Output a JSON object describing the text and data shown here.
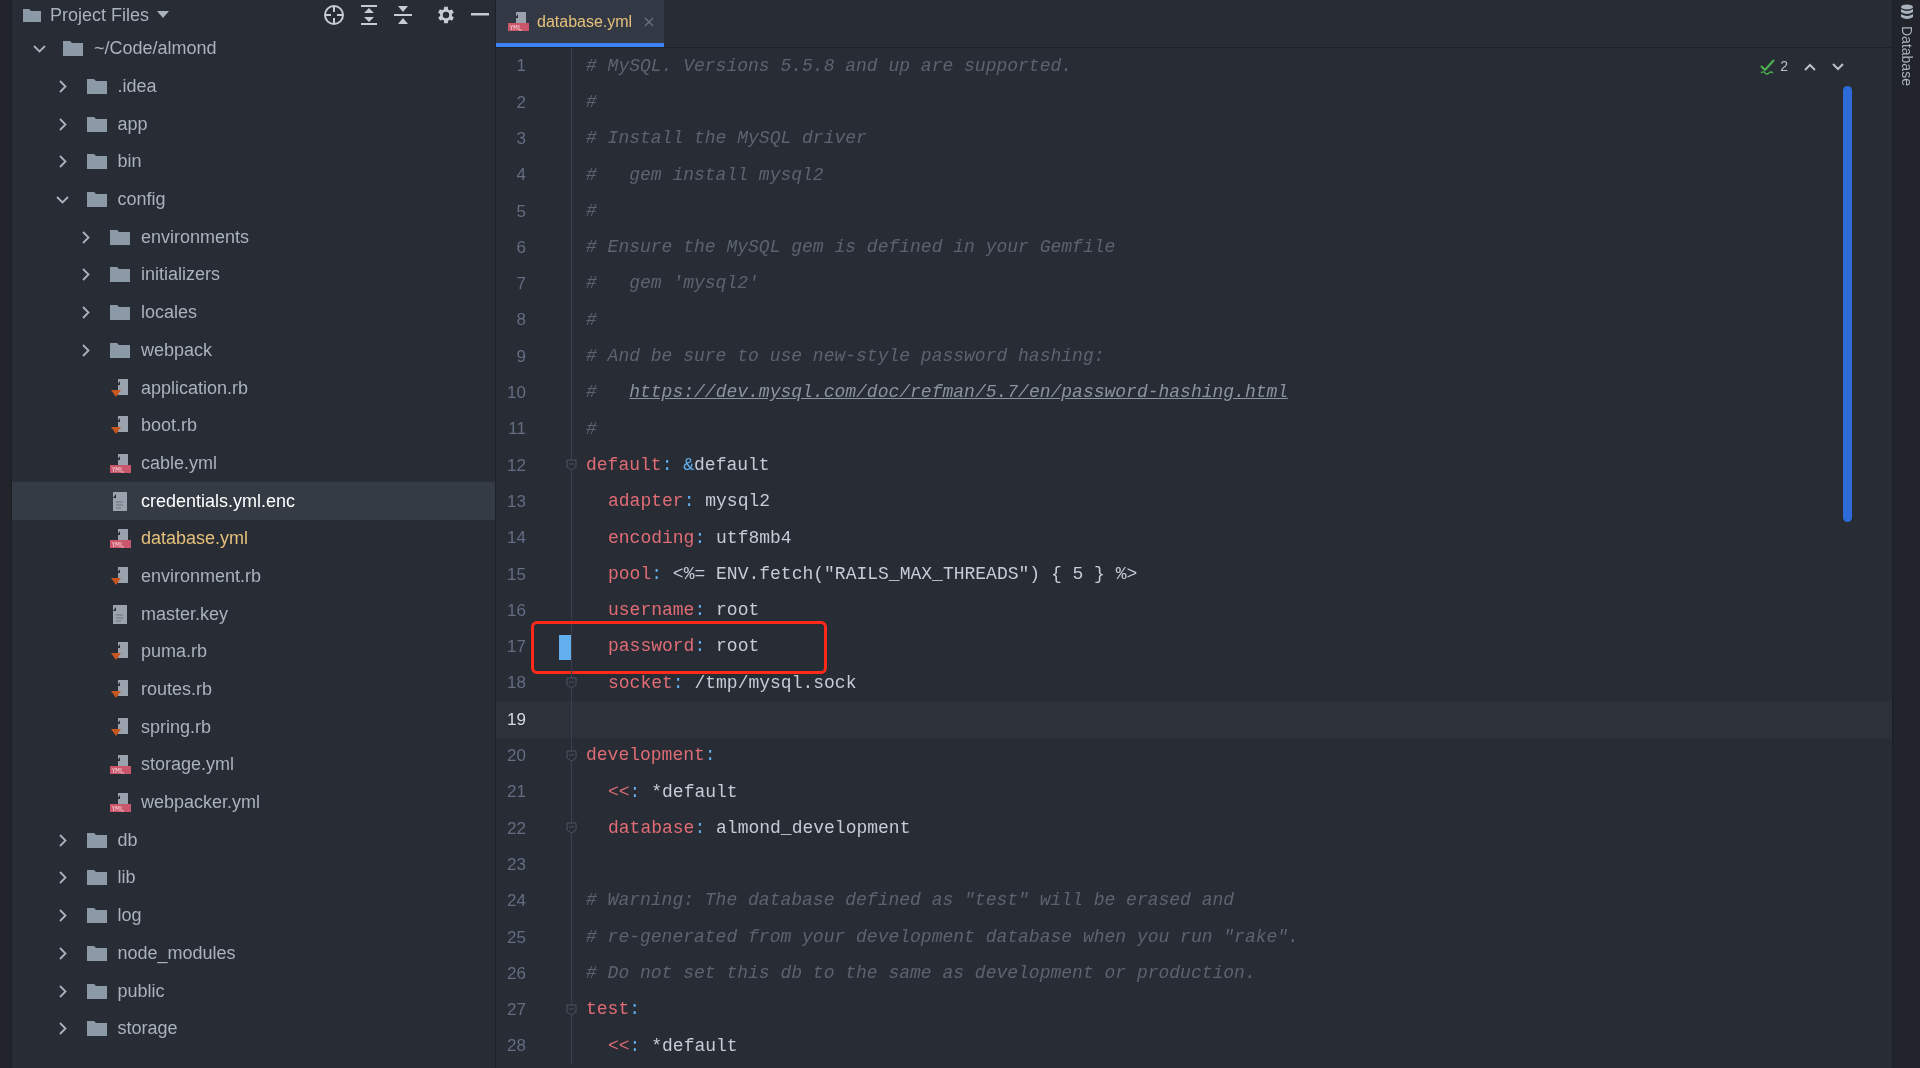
{
  "project_panel": {
    "title": "Project Files",
    "tree": [
      {
        "label": "~/Code/almond",
        "kind": "folder",
        "expanded": true,
        "selected": false,
        "modified": false,
        "children": [
          {
            "label": ".idea",
            "kind": "folder",
            "expanded": false,
            "selected": false,
            "modified": false
          },
          {
            "label": "app",
            "kind": "folder",
            "expanded": false,
            "selected": false,
            "modified": false
          },
          {
            "label": "bin",
            "kind": "folder",
            "expanded": false,
            "selected": false,
            "modified": false
          },
          {
            "label": "config",
            "kind": "folder",
            "expanded": true,
            "selected": false,
            "modified": false,
            "children": [
              {
                "label": "environments",
                "kind": "folder",
                "expanded": false,
                "selected": false,
                "modified": false
              },
              {
                "label": "initializers",
                "kind": "folder",
                "expanded": false,
                "selected": false,
                "modified": false
              },
              {
                "label": "locales",
                "kind": "folder",
                "expanded": false,
                "selected": false,
                "modified": false
              },
              {
                "label": "webpack",
                "kind": "folder",
                "expanded": false,
                "selected": false,
                "modified": false
              },
              {
                "label": "application.rb",
                "kind": "ruby",
                "selected": false,
                "modified": false
              },
              {
                "label": "boot.rb",
                "kind": "ruby",
                "selected": false,
                "modified": false
              },
              {
                "label": "cable.yml",
                "kind": "yaml",
                "selected": false,
                "modified": false
              },
              {
                "label": "credentials.yml.enc",
                "kind": "text",
                "selected": true,
                "modified": false
              },
              {
                "label": "database.yml",
                "kind": "yaml",
                "selected": false,
                "modified": true
              },
              {
                "label": "environment.rb",
                "kind": "ruby",
                "selected": false,
                "modified": false
              },
              {
                "label": "master.key",
                "kind": "text",
                "selected": false,
                "modified": false
              },
              {
                "label": "puma.rb",
                "kind": "ruby",
                "selected": false,
                "modified": false
              },
              {
                "label": "routes.rb",
                "kind": "ruby",
                "selected": false,
                "modified": false
              },
              {
                "label": "spring.rb",
                "kind": "ruby",
                "selected": false,
                "modified": false
              },
              {
                "label": "storage.yml",
                "kind": "yaml",
                "selected": false,
                "modified": false
              },
              {
                "label": "webpacker.yml",
                "kind": "yaml",
                "selected": false,
                "modified": false
              }
            ]
          },
          {
            "label": "db",
            "kind": "folder",
            "expanded": false,
            "selected": false,
            "modified": false
          },
          {
            "label": "lib",
            "kind": "folder",
            "expanded": false,
            "selected": false,
            "modified": false
          },
          {
            "label": "log",
            "kind": "folder",
            "expanded": false,
            "selected": false,
            "modified": false
          },
          {
            "label": "node_modules",
            "kind": "folder",
            "expanded": false,
            "selected": false,
            "modified": false
          },
          {
            "label": "public",
            "kind": "folder",
            "expanded": false,
            "selected": false,
            "modified": false
          },
          {
            "label": "storage",
            "kind": "folder",
            "expanded": false,
            "selected": false,
            "modified": false
          }
        ]
      }
    ]
  },
  "tabs": [
    {
      "label": "database.yml",
      "selected": true
    }
  ],
  "inspections": {
    "count": "2"
  },
  "right_strip": {
    "label": "Database"
  },
  "editor": {
    "lines": [
      {
        "number": "1",
        "indented": false,
        "fold": false,
        "current": false,
        "changed": false,
        "boxed": false,
        "tokens": [
          {
            "kind": "comment",
            "text": "# MySQL. Versions 5.5.8 and up are supported."
          }
        ]
      },
      {
        "number": "2",
        "indented": false,
        "fold": false,
        "current": false,
        "changed": false,
        "boxed": false,
        "tokens": [
          {
            "kind": "comment",
            "text": "#"
          }
        ]
      },
      {
        "number": "3",
        "indented": false,
        "fold": false,
        "current": false,
        "changed": false,
        "boxed": false,
        "tokens": [
          {
            "kind": "comment",
            "text": "# Install the MySQL driver"
          }
        ]
      },
      {
        "number": "4",
        "indented": false,
        "fold": false,
        "current": false,
        "changed": false,
        "boxed": false,
        "tokens": [
          {
            "kind": "comment",
            "text": "#   gem install mysql2"
          }
        ]
      },
      {
        "number": "5",
        "indented": false,
        "fold": false,
        "current": false,
        "changed": false,
        "boxed": false,
        "tokens": [
          {
            "kind": "comment",
            "text": "#"
          }
        ]
      },
      {
        "number": "6",
        "indented": false,
        "fold": false,
        "current": false,
        "changed": false,
        "boxed": false,
        "tokens": [
          {
            "kind": "comment",
            "text": "# Ensure the MySQL gem is defined in your Gemfile"
          }
        ]
      },
      {
        "number": "7",
        "indented": false,
        "fold": false,
        "current": false,
        "changed": false,
        "boxed": false,
        "tokens": [
          {
            "kind": "comment",
            "text": "#   gem 'mysql2'"
          }
        ]
      },
      {
        "number": "8",
        "indented": false,
        "fold": false,
        "current": false,
        "changed": false,
        "boxed": false,
        "tokens": [
          {
            "kind": "comment",
            "text": "#"
          }
        ]
      },
      {
        "number": "9",
        "indented": false,
        "fold": false,
        "current": false,
        "changed": false,
        "boxed": false,
        "tokens": [
          {
            "kind": "comment",
            "text": "# And be sure to use new-style password hashing:"
          }
        ]
      },
      {
        "number": "10",
        "indented": false,
        "fold": false,
        "current": false,
        "changed": false,
        "boxed": false,
        "tokens": [
          {
            "kind": "comment",
            "text": "#   "
          },
          {
            "kind": "link",
            "text": "https://dev.mysql.com/doc/refman/5.7/en/password-hashing.html"
          }
        ]
      },
      {
        "number": "11",
        "indented": false,
        "fold": false,
        "current": false,
        "changed": false,
        "boxed": false,
        "tokens": [
          {
            "kind": "comment",
            "text": "#"
          }
        ]
      },
      {
        "number": "12",
        "indented": false,
        "fold": true,
        "current": false,
        "changed": false,
        "boxed": false,
        "tokens": [
          {
            "kind": "key",
            "text": "default"
          },
          {
            "kind": "punct",
            "text": ": &"
          },
          {
            "kind": "value",
            "text": "default"
          }
        ]
      },
      {
        "number": "13",
        "indented": true,
        "fold": false,
        "current": false,
        "changed": false,
        "boxed": false,
        "tokens": [
          {
            "kind": "key",
            "text": "adapter"
          },
          {
            "kind": "punct",
            "text": ":"
          },
          {
            "kind": "value",
            "text": " mysql2"
          }
        ]
      },
      {
        "number": "14",
        "indented": true,
        "fold": false,
        "current": false,
        "changed": false,
        "boxed": false,
        "tokens": [
          {
            "kind": "key",
            "text": "encoding"
          },
          {
            "kind": "punct",
            "text": ":"
          },
          {
            "kind": "value",
            "text": " utf8mb4"
          }
        ]
      },
      {
        "number": "15",
        "indented": true,
        "fold": false,
        "current": false,
        "changed": false,
        "boxed": false,
        "tokens": [
          {
            "kind": "key",
            "text": "pool"
          },
          {
            "kind": "punct",
            "text": ":"
          },
          {
            "kind": "value",
            "text": " <%= ENV.fetch(\"RAILS_MAX_THREADS\") { 5 } %>"
          }
        ]
      },
      {
        "number": "16",
        "indented": true,
        "fold": false,
        "current": false,
        "changed": false,
        "boxed": false,
        "tokens": [
          {
            "kind": "key",
            "text": "username"
          },
          {
            "kind": "punct",
            "text": ":"
          },
          {
            "kind": "value",
            "text": " root"
          }
        ]
      },
      {
        "number": "17",
        "indented": true,
        "fold": false,
        "current": false,
        "changed": true,
        "boxed": true,
        "tokens": [
          {
            "kind": "key",
            "text": "password"
          },
          {
            "kind": "punct",
            "text": ":"
          },
          {
            "kind": "value",
            "text": " root"
          }
        ]
      },
      {
        "number": "18",
        "indented": true,
        "fold": true,
        "current": false,
        "changed": false,
        "boxed": false,
        "tokens": [
          {
            "kind": "key",
            "text": "socket"
          },
          {
            "kind": "punct",
            "text": ":"
          },
          {
            "kind": "value",
            "text": " /tmp/mysql.sock"
          }
        ]
      },
      {
        "number": "19",
        "fold": false,
        "current": true,
        "changed": false,
        "boxed": false
      },
      {
        "number": "20",
        "indented": false,
        "fold": true,
        "current": false,
        "changed": false,
        "boxed": false,
        "tokens": [
          {
            "kind": "key",
            "text": "development"
          },
          {
            "kind": "punct",
            "text": ":"
          }
        ]
      },
      {
        "number": "21",
        "indented": true,
        "fold": false,
        "current": false,
        "changed": false,
        "boxed": false,
        "tokens": [
          {
            "kind": "key",
            "text": "<<"
          },
          {
            "kind": "punct",
            "text": ":"
          },
          {
            "kind": "value",
            "text": " *default"
          }
        ]
      },
      {
        "number": "22",
        "indented": true,
        "fold": true,
        "current": false,
        "changed": false,
        "boxed": false,
        "tokens": [
          {
            "kind": "key",
            "text": "database"
          },
          {
            "kind": "punct",
            "text": ":"
          },
          {
            "kind": "value",
            "text": " almond_development"
          }
        ]
      },
      {
        "number": "23",
        "fold": false,
        "current": false,
        "changed": false,
        "boxed": false
      },
      {
        "number": "24",
        "indented": false,
        "fold": false,
        "current": false,
        "changed": false,
        "boxed": false,
        "tokens": [
          {
            "kind": "comment",
            "text": "# Warning: The database defined as \"test\" will be erased and"
          }
        ]
      },
      {
        "number": "25",
        "indented": false,
        "fold": false,
        "current": false,
        "changed": false,
        "boxed": false,
        "tokens": [
          {
            "kind": "comment",
            "text": "# re-generated from your development database when you run \"rake\"."
          }
        ]
      },
      {
        "number": "26",
        "indented": false,
        "fold": false,
        "current": false,
        "changed": false,
        "boxed": false,
        "tokens": [
          {
            "kind": "comment",
            "text": "# Do not set this db to the same as development or production."
          }
        ]
      },
      {
        "number": "27",
        "indented": false,
        "fold": true,
        "current": false,
        "changed": false,
        "boxed": false,
        "tokens": [
          {
            "kind": "key",
            "text": "test"
          },
          {
            "kind": "punct",
            "text": ":"
          }
        ]
      },
      {
        "number": "28",
        "indented": true,
        "fold": false,
        "current": false,
        "changed": false,
        "boxed": false,
        "tokens": [
          {
            "kind": "key",
            "text": "<<"
          },
          {
            "kind": "punct",
            "text": ":"
          },
          {
            "kind": "value",
            "text": " *default"
          }
        ]
      }
    ]
  }
}
